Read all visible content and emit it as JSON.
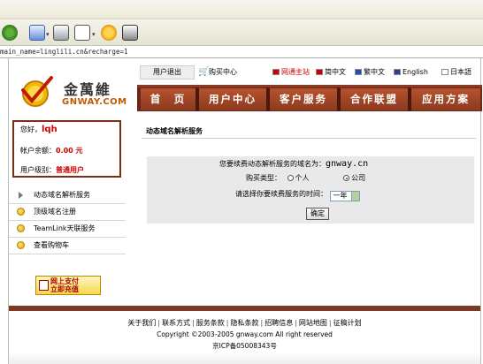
{
  "browser": {
    "address": "main_name=linglili.cn&recharge=1",
    "toolbar_icons": [
      "refresh-icon",
      "mail-icon",
      "print-icon",
      "edit-icon",
      "messenger-icon",
      "research-icon"
    ]
  },
  "utility": {
    "logout": "用户退出",
    "cart": "购买中心",
    "languages": [
      {
        "label": "网通主站",
        "color": "#cc0000"
      },
      {
        "label": "简中文",
        "color": "#000000"
      },
      {
        "label": "繁中文",
        "color": "#000000"
      },
      {
        "label": "English",
        "color": "#000000"
      },
      {
        "label": "日本語",
        "color": "#000000"
      }
    ]
  },
  "logo": {
    "cn": "金萬維",
    "en": "GNWAY.COM"
  },
  "nav": {
    "tabs": [
      "首　页",
      "用户中心",
      "客户服务",
      "合作联盟",
      "应用方案"
    ]
  },
  "user_box": {
    "greeting_label": "您好，",
    "username": "lqh",
    "balance_label": "帐户余额：",
    "balance_value": "0.00 元",
    "level_label": "用户级别：",
    "level_value": "普通用户"
  },
  "side_menu": {
    "items": [
      "动态域名解析服务",
      "顶级域名注册",
      "TeamLink天联服务",
      "查看购物车"
    ]
  },
  "pay_banner": {
    "line1": "网上支付",
    "line2": "立即充值"
  },
  "content": {
    "title": "动态域名解析服务",
    "domain_label": "您要续费动态解析服务的域名为：",
    "domain_value": "gnway.cn",
    "type_label": "购买类型：",
    "type_options": [
      "个人",
      "公司"
    ],
    "type_selected": "公司",
    "period_label": "请选择你要续费服务的时间：",
    "period_value": "一年",
    "confirm": "确定"
  },
  "footer": {
    "links": [
      "关于我们",
      "联系方式",
      "服务条款",
      "隐私条款",
      "招聘信息",
      "网站地图",
      "征稿计划"
    ],
    "copyright": "Copyright ©2003-2005 gnway.com All right reserved",
    "icp": "京ICP备05008343号"
  },
  "colors": {
    "nav_dark": "#6c2718",
    "nav_tab": "#a6472a",
    "accent_red": "#d10000",
    "form_bg": "#e9e9e9"
  }
}
